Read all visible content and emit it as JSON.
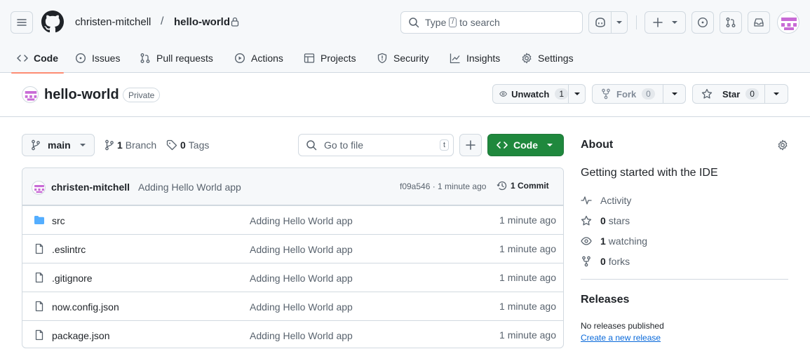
{
  "header": {
    "owner": "christen-mitchell",
    "separator": "/",
    "repo": "hello-world",
    "search": {
      "before": "Type",
      "key": "/",
      "after": "to search"
    }
  },
  "nav": {
    "tabs": [
      {
        "label": "Code",
        "icon": "code-icon",
        "active": true
      },
      {
        "label": "Issues",
        "icon": "issue-opened-icon"
      },
      {
        "label": "Pull requests",
        "icon": "git-pull-request-icon"
      },
      {
        "label": "Actions",
        "icon": "play-icon"
      },
      {
        "label": "Projects",
        "icon": "table-icon"
      },
      {
        "label": "Security",
        "icon": "shield-icon"
      },
      {
        "label": "Insights",
        "icon": "graph-icon"
      },
      {
        "label": "Settings",
        "icon": "gear-icon"
      }
    ]
  },
  "repo_header": {
    "title": "hello-world",
    "visibility": "Private",
    "watch": {
      "label": "Unwatch",
      "count": "1"
    },
    "fork": {
      "label": "Fork",
      "count": "0"
    },
    "star": {
      "label": "Star",
      "count": "0"
    }
  },
  "toolbar": {
    "branch": "main",
    "branches": {
      "count": "1",
      "label": "Branch"
    },
    "tags": {
      "count": "0",
      "label": "Tags"
    },
    "goto_placeholder": "Go to file",
    "goto_key": "t",
    "code_label": "Code"
  },
  "latest_commit": {
    "author": "christen-mitchell",
    "message": "Adding Hello World app",
    "sha_age": "f09a546 · 1 minute ago",
    "commits": "1 Commit"
  },
  "files": [
    {
      "name": "src",
      "type": "dir",
      "message": "Adding Hello World app",
      "age": "1 minute ago"
    },
    {
      "name": ".eslintrc",
      "type": "file",
      "message": "Adding Hello World app",
      "age": "1 minute ago"
    },
    {
      "name": ".gitignore",
      "type": "file",
      "message": "Adding Hello World app",
      "age": "1 minute ago"
    },
    {
      "name": "now.config.json",
      "type": "file",
      "message": "Adding Hello World app",
      "age": "1 minute ago"
    },
    {
      "name": "package.json",
      "type": "file",
      "message": "Adding Hello World app",
      "age": "1 minute ago"
    }
  ],
  "about": {
    "title": "About",
    "description": "Getting started with the IDE",
    "activity": "Activity",
    "stars": {
      "count": "0",
      "label": "stars"
    },
    "watching": {
      "count": "1",
      "label": "watching"
    },
    "forks": {
      "count": "0",
      "label": "forks"
    }
  },
  "releases": {
    "title": "Releases",
    "none": "No releases published",
    "create": "Create a new release"
  },
  "colors": {
    "accent": "#1f883d",
    "link": "#0969da",
    "tab_underline": "#fd8c73",
    "folder": "#54aeff",
    "avatar": "#c86bd6"
  }
}
